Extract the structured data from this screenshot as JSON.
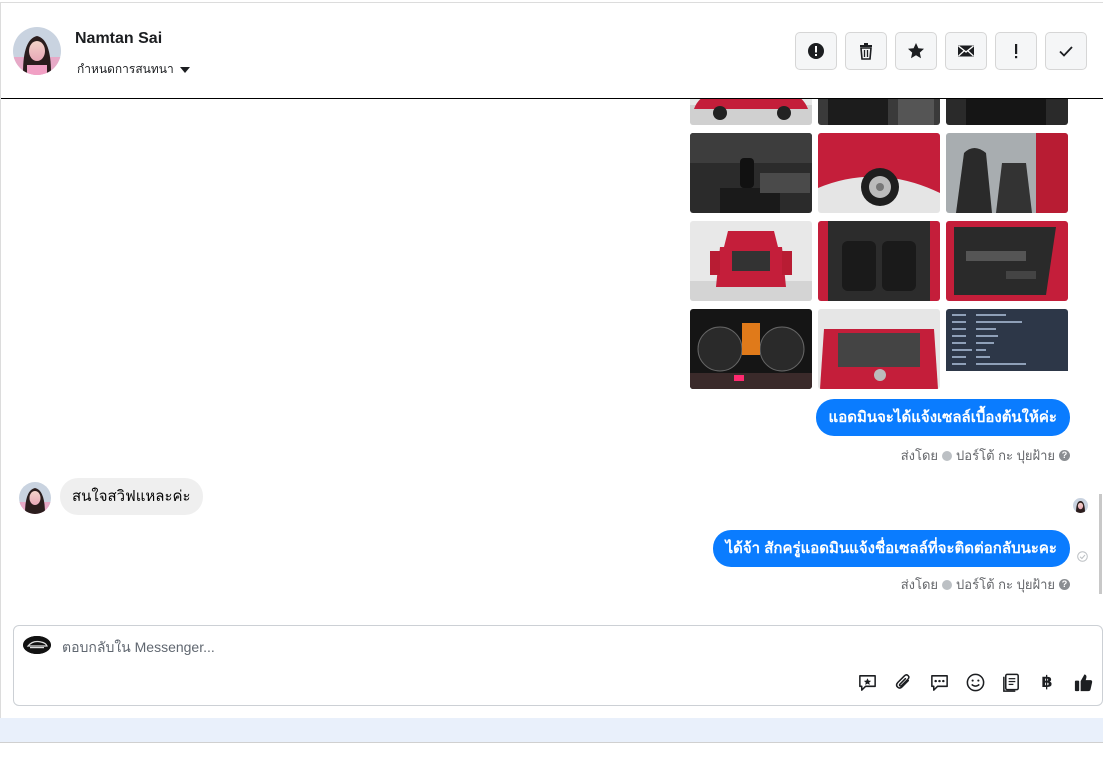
{
  "header": {
    "name": "Namtan Sai",
    "assign_label": "กำหนดการสนทนา",
    "toolbar": [
      {
        "name": "report-spam-button",
        "icon": "alert-circle-icon"
      },
      {
        "name": "delete-button",
        "icon": "trash-icon"
      },
      {
        "name": "star-button",
        "icon": "star-icon"
      },
      {
        "name": "mark-unread-button",
        "icon": "envelope-icon"
      },
      {
        "name": "follow-up-button",
        "icon": "exclamation-icon"
      },
      {
        "name": "mark-done-button",
        "icon": "check-icon"
      }
    ]
  },
  "conversation": {
    "images": [
      {
        "name": "car-photo-exterior-front",
        "icon": "photo"
      },
      {
        "name": "car-photo-interior-floor",
        "icon": "photo"
      },
      {
        "name": "car-photo-interior-dark",
        "icon": "photo"
      },
      {
        "name": "car-photo-gear-shift",
        "icon": "photo"
      },
      {
        "name": "car-photo-wheel",
        "icon": "photo"
      },
      {
        "name": "car-photo-front-seats",
        "icon": "photo"
      },
      {
        "name": "car-photo-rear-open",
        "icon": "photo"
      },
      {
        "name": "car-photo-rear-seats",
        "icon": "photo"
      },
      {
        "name": "car-photo-door-panel",
        "icon": "photo"
      },
      {
        "name": "car-photo-dashboard-gauges",
        "icon": "photo"
      },
      {
        "name": "car-photo-engine-bay",
        "icon": "photo"
      },
      {
        "name": "car-spec-sheet",
        "icon": "document"
      }
    ],
    "messages": [
      {
        "direction": "out",
        "text": "แอดมินจะได้แจ้งเซลล์เบื้องต้นให้ค่ะ"
      },
      {
        "direction": "in",
        "text": "สนใจสวิฟแหละค่ะ"
      },
      {
        "direction": "out",
        "text": "ได้จ้า สักครู่แอดมินแจ้งชื่อเซลล์ที่จะติดต่อกลับนะคะ"
      }
    ],
    "sent_by": {
      "prefix": "ส่งโดย",
      "sender": "ปอร์โต้ กะ ปุยฝ้าย"
    }
  },
  "composer": {
    "placeholder": "ตอบกลับใน Messenger...",
    "tools": [
      {
        "name": "saved-reply-button",
        "icon": "chat-star-icon"
      },
      {
        "name": "attach-button",
        "icon": "paperclip-icon"
      },
      {
        "name": "quick-replies-button",
        "icon": "chat-dots-icon"
      },
      {
        "name": "emoji-button",
        "icon": "smiley-icon"
      },
      {
        "name": "catalog-button",
        "icon": "book-icon"
      },
      {
        "name": "payment-button",
        "icon": "baht-icon",
        "label": "฿"
      },
      {
        "name": "like-button",
        "icon": "thumbs-up-icon"
      }
    ]
  },
  "colors": {
    "accent": "#0a7cff",
    "bubble_in": "#efefef",
    "muted_text": "#65676b"
  }
}
